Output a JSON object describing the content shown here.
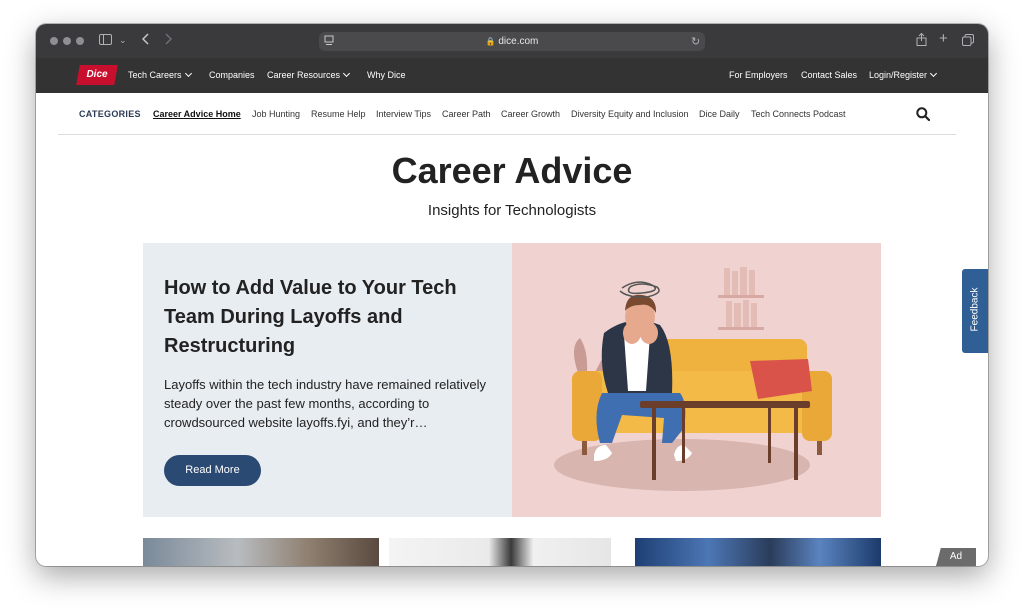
{
  "browser": {
    "url": "dice.com"
  },
  "nav": {
    "logo_text": "Dice",
    "left_items": [
      {
        "label": "Tech Careers",
        "dropdown": true
      },
      {
        "label": "Companies",
        "dropdown": false
      },
      {
        "label": "Career Resources",
        "dropdown": true
      },
      {
        "label": "Why Dice",
        "dropdown": false
      }
    ],
    "right_items": [
      {
        "label": "For Employers"
      },
      {
        "label": "Contact Sales"
      },
      {
        "label": "Login/Register",
        "dropdown": true
      }
    ]
  },
  "categories": {
    "label": "CATEGORIES",
    "items": [
      {
        "label": "Career Advice Home",
        "active": true
      },
      {
        "label": "Job Hunting"
      },
      {
        "label": "Resume Help"
      },
      {
        "label": "Interview Tips"
      },
      {
        "label": "Career Path"
      },
      {
        "label": "Career Growth"
      },
      {
        "label": "Diversity Equity and Inclusion"
      },
      {
        "label": "Dice Daily"
      },
      {
        "label": "Tech Connects Podcast"
      }
    ]
  },
  "hero": {
    "title": "Career Advice",
    "subtitle": "Insights for Technologists"
  },
  "featured": {
    "title": "How to Add Value to Your Tech Team During Layoffs and Restructuring",
    "excerpt": "Layoffs within the tech industry have remained relatively steady over the past few months, according to crowdsourced website layoffs.fyi, and they’r…",
    "button_label": "Read More"
  },
  "feedback_label": "Feedback",
  "ad_label": "Ad",
  "colors": {
    "brand_red": "#c8102e",
    "nav_bg": "#333333",
    "button_blue": "#2a4a73",
    "feedback_blue": "#2f5f94"
  }
}
